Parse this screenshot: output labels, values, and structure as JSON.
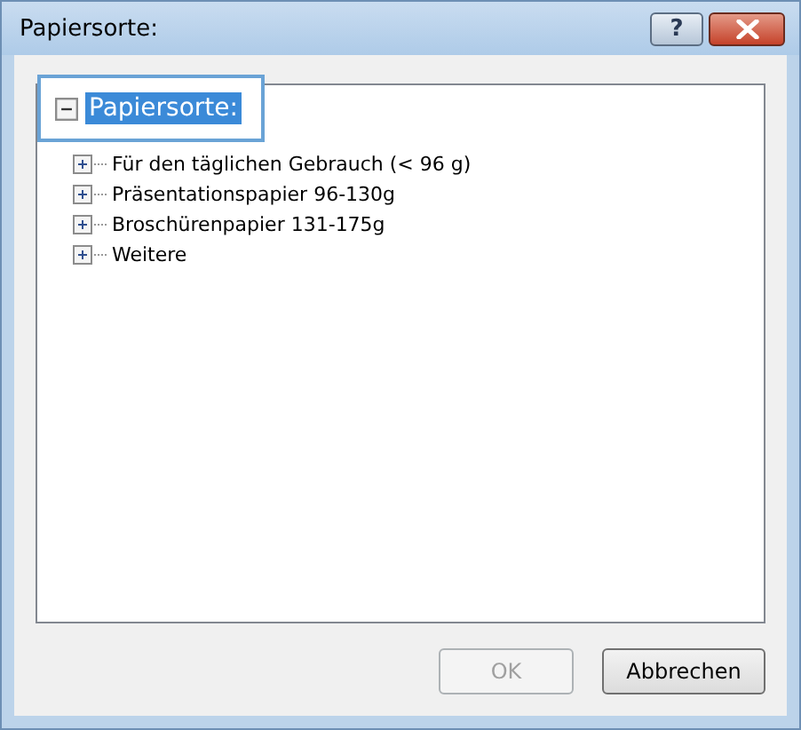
{
  "window": {
    "title": "Papiersorte:"
  },
  "title_buttons": [
    {
      "kind": "help",
      "label": "?"
    },
    {
      "kind": "close"
    }
  ],
  "tree": {
    "label": "Papiersorte:",
    "expanded": true,
    "selected": true,
    "children": [
      {
        "label": "Für den täglichen Gebrauch (< 96 g)",
        "expanded": false
      },
      {
        "label": "Präsentationspapier 96-130g",
        "expanded": false
      },
      {
        "label": "Broschürenpapier 131-175g",
        "expanded": false
      },
      {
        "label": "Weitere",
        "expanded": false
      }
    ]
  },
  "buttons": [
    {
      "label": "OK",
      "disabled": true
    },
    {
      "label": "Abbrechen",
      "disabled": false
    }
  ]
}
